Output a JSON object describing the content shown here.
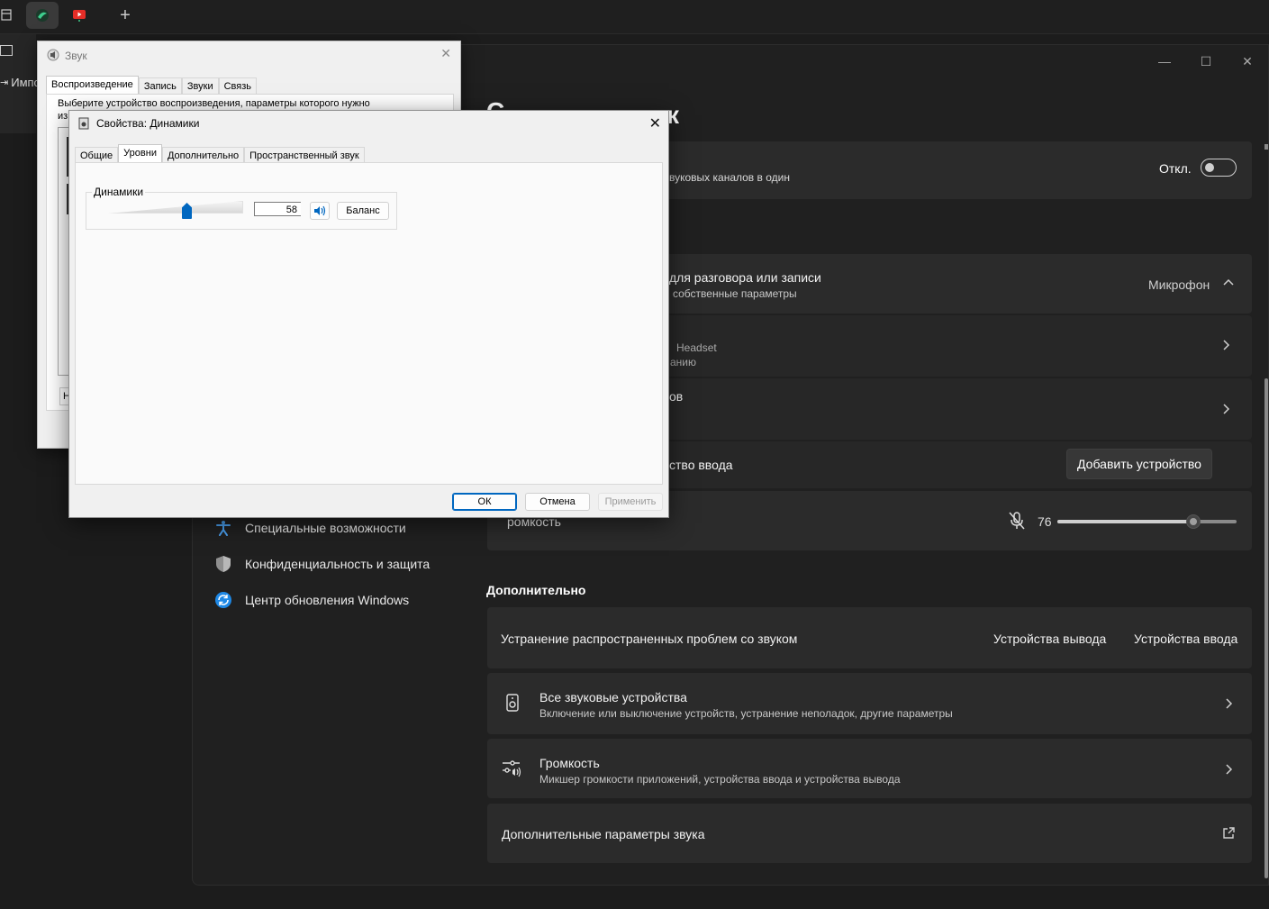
{
  "browser": {
    "new_tab_symbol": "+"
  },
  "left_partial": {
    "import_label": "Импо"
  },
  "settings": {
    "header_partial": "С",
    "header_partial_end": "к",
    "mono_audio": {
      "subtitle_partial": "вуковых каналов в один",
      "toggle_label": "Откл.",
      "toggle_on": false
    },
    "input_section": {
      "title_partial": "для разговора или записи",
      "subtitle_partial": "собственные параметры",
      "value": "Микрофон"
    },
    "device_headset": {
      "title_partial": "Headset",
      "subtitle_partial": "анию"
    },
    "device_row2": {
      "title_partial": "ов"
    },
    "add_device": {
      "label_partial": "ство ввода",
      "button": "Добавить устройство"
    },
    "volume_row": {
      "label_partial": "ромкость",
      "value": "76",
      "level_percent": 76
    },
    "nav": [
      {
        "label": "Специальные возможности",
        "icon": "accessibility-icon"
      },
      {
        "label": "Конфиденциальность и защита",
        "icon": "shield-icon"
      },
      {
        "label": "Центр обновления Windows",
        "icon": "update-icon"
      }
    ],
    "advanced": {
      "title": "Дополнительно",
      "troubleshoot": {
        "title": "Устранение распространенных проблем со звуком",
        "output_link": "Устройства вывода",
        "input_link": "Устройства ввода"
      },
      "all_devices": {
        "title": "Все звуковые устройства",
        "subtitle": "Включение или выключение устройств, устранение неполадок, другие параметры"
      },
      "mixer": {
        "title": "Громкость",
        "subtitle": "Микшер громкости приложений, устройства ввода и устройства вывода"
      },
      "more_settings": {
        "title": "Дополнительные параметры звука"
      }
    }
  },
  "sound_dialog": {
    "title": "Звук",
    "tabs": [
      "Воспроизведение",
      "Запись",
      "Звуки",
      "Связь"
    ],
    "instruction_line1": "Выберите устройство воспроизведения, параметры которого нужно",
    "instruction_line2": "из",
    "partial_button": "Н"
  },
  "properties_dialog": {
    "title": "Свойства: Динамики",
    "tabs": [
      "Общие",
      "Уровни",
      "Дополнительно",
      "Пространственный звук"
    ],
    "group_label": "Динамики",
    "level_value": "58",
    "level_percent": 58,
    "balance_button": "Баланс",
    "ok_button": "ОК",
    "cancel_button": "Отмена",
    "apply_button": "Применить"
  },
  "colors": {
    "accent": "#0067c0",
    "settings_bg": "#202020",
    "card_bg": "#2b2b2b"
  }
}
